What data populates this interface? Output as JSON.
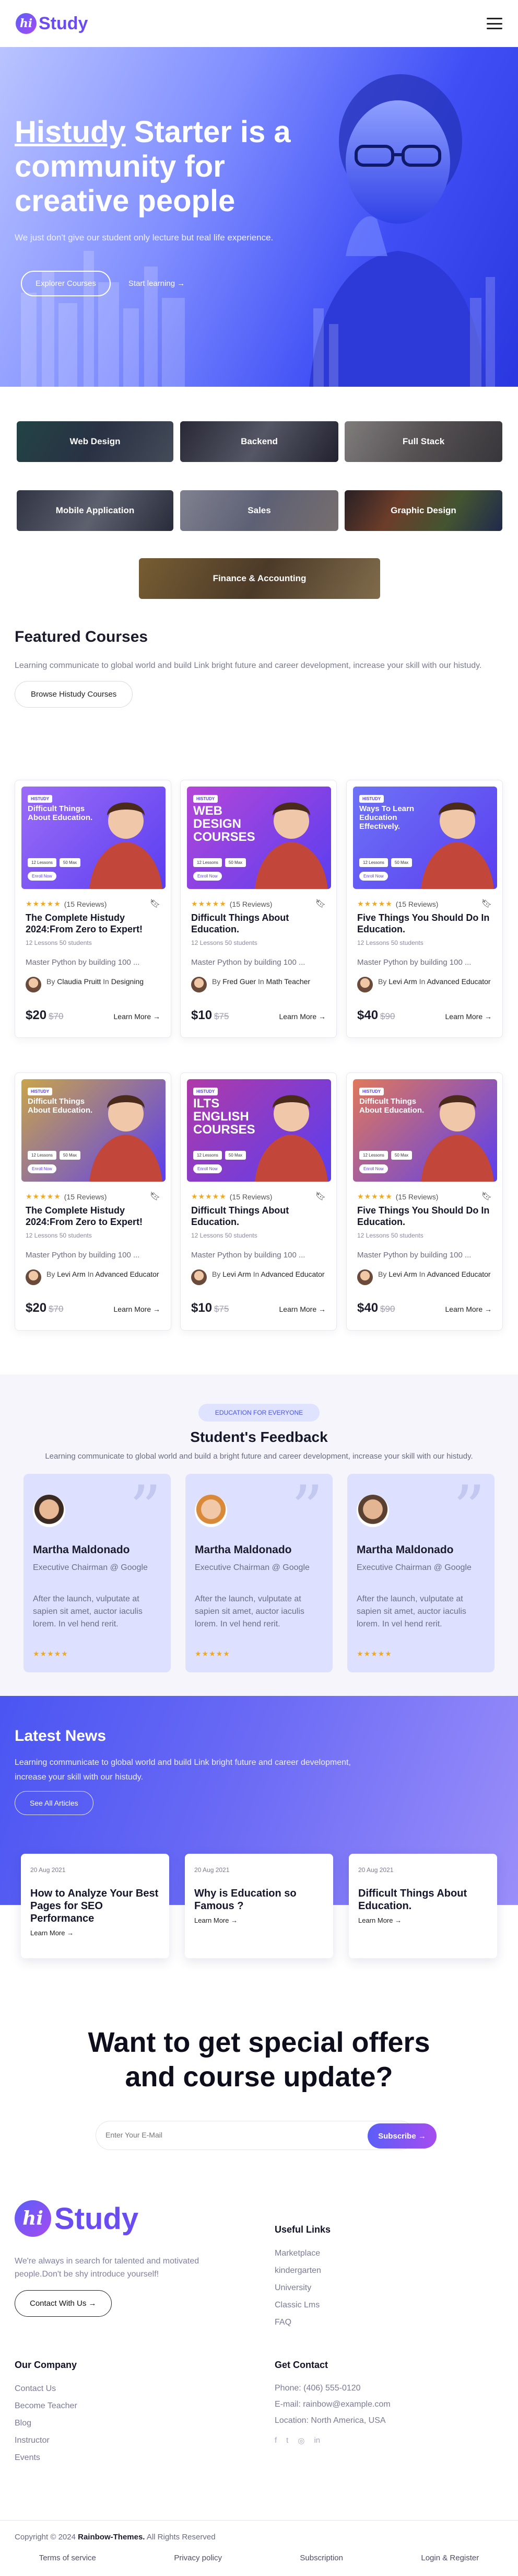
{
  "header": {
    "logo_mark": "hi",
    "logo_text": "Study"
  },
  "hero": {
    "title_brand": "Histudy",
    "title_rest": " Starter is a community for creative people",
    "subtitle": "We just don't give our student only lecture but real life experience.",
    "primary_button": "Explorer Courses",
    "secondary_link": "Start learning",
    "arrow": "→"
  },
  "categories": [
    "Web Design",
    "Backend",
    "Full Stack",
    "Mobile Application",
    "Sales",
    "Graphic Design",
    "Finance & Accounting"
  ],
  "featured": {
    "title": "Featured Courses",
    "description": "Learning communicate to global world and build Link bright future and career development, increase your skill with our histudy.",
    "button": "Browse Histudy Courses"
  },
  "courses": [
    {
      "thumb_title": "Difficult Things About Education.",
      "rating": "(15 Reviews)",
      "title": "The Complete Histudy 2024:From Zero to Expert!",
      "meta": "12 Lessons  50 students",
      "desc": "Master Python by building 100 ...",
      "by": "By",
      "author": "Claudia Pruitt",
      "in": "In",
      "category": "Designing",
      "price": "$20",
      "old_price": "$70",
      "learn": "Learn More →",
      "accent": "#9b6cf7"
    },
    {
      "thumb_title": "WEB DESIGN COURSES",
      "rating": "(15 Reviews)",
      "title": "Difficult Things About Education.",
      "meta": "12 Lessons  50 students",
      "desc": "Master Python by building 100 ...",
      "by": "By",
      "author": "Fred Guer",
      "in": "In",
      "category": "Math Teacher",
      "price": "$10",
      "old_price": "$75",
      "learn": "Learn More →",
      "accent": "#b446d8"
    },
    {
      "thumb_title": "Ways To Learn Education Effectively.",
      "rating": "(15 Reviews)",
      "title": "Five Things You Should Do In Education.",
      "meta": "12 Lessons  50 students",
      "desc": "Master Python by building 100 ...",
      "by": "By",
      "author": "Levi Arm",
      "in": "In",
      "category": "Advanced Educator",
      "price": "$40",
      "old_price": "$90",
      "learn": "Learn More →",
      "accent": "#6d72f5"
    },
    {
      "thumb_title": "Difficult Things About Education.",
      "rating": "(15 Reviews)",
      "title": "The Complete Histudy 2024:From Zero to Expert!",
      "meta": "12 Lessons  50 students",
      "desc": "Master Python by building 100 ...",
      "by": "By",
      "author": "Levi Arm",
      "in": "In",
      "category": "Advanced Educator",
      "price": "$20",
      "old_price": "$70",
      "learn": "Learn More →",
      "accent": "#c9a44a"
    },
    {
      "thumb_title": "ILTS ENGLISH COURSES",
      "rating": "(15 Reviews)",
      "title": "Difficult Things About Education.",
      "meta": "12 Lessons  50 students",
      "desc": "Master Python by building 100 ...",
      "by": "By",
      "author": "Levi Arm",
      "in": "In",
      "category": "Advanced Educator",
      "price": "$10",
      "old_price": "$75",
      "learn": "Learn More →",
      "accent": "#b03aa8"
    },
    {
      "thumb_title": "Difficult Things About Education.",
      "rating": "(15 Reviews)",
      "title": "Five Things You Should Do In Education.",
      "meta": "12 Lessons  50 students",
      "desc": "Master Python by building 100 ...",
      "by": "By",
      "author": "Levi Arm",
      "in": "In",
      "category": "Advanced Educator",
      "price": "$40",
      "old_price": "$90",
      "learn": "Learn More →",
      "accent": "#e0785a"
    }
  ],
  "thumb_ui": {
    "tag": "HISTUDY",
    "pill_one": "12 Lessons",
    "pill_two": "50 Max",
    "enroll": "Enroll Now"
  },
  "feedback": {
    "badge": "EDUCATION FOR EVERYONE",
    "title": "Student's Feedback",
    "subtitle": "Learning communicate to global world and build a bright future and career development, increase your skill with our histudy.",
    "items": [
      {
        "name": "Martha Maldonado",
        "role": "Executive Chairman @ Google",
        "text": "After the launch, vulputate at sapien sit amet, auctor iaculis lorem. In vel hend rerit.",
        "stars": "★★★★★"
      },
      {
        "name": "Martha Maldonado",
        "role": "Executive Chairman @ Google",
        "text": "After the launch, vulputate at sapien sit amet, auctor iaculis lorem. In vel hend rerit.",
        "stars": "★★★★★"
      },
      {
        "name": "Martha Maldonado",
        "role": "Executive Chairman @ Google",
        "text": "After the launch, vulputate at sapien sit amet, auctor iaculis lorem. In vel hend rerit.",
        "stars": "★★★★★"
      }
    ]
  },
  "news": {
    "title": "Latest News",
    "subtitle": "Learning communicate to global world and build Link bright future and career development, increase your skill with our histudy.",
    "button": "See All Articles",
    "items": [
      {
        "date": "20 Aug 2021",
        "title": "How to Analyze Your Best Pages for SEO Performance",
        "link": "Learn More →"
      },
      {
        "date": "20 Aug 2021",
        "title": "Why is Education so Famous ?",
        "link": "Learn More →"
      },
      {
        "date": "20 Aug 2021",
        "title": "Difficult Things About Education.",
        "link": "Learn More →"
      }
    ]
  },
  "newsletter": {
    "title_line1": "Want to get special offers",
    "title_line2": "and course update?",
    "placeholder": "Enter Your E-Mail",
    "button": "Subscribe →"
  },
  "footer": {
    "about": "We're always in search for talented and motivated people.Don't be shy introduce yourself!",
    "contact_button": "Contact With Us →",
    "useful_title": "Useful Links",
    "useful_links": [
      "Marketplace",
      "kindergarten",
      "University",
      "Classic Lms",
      "FAQ"
    ],
    "company_title": "Our Company",
    "company_links": [
      "Contact Us",
      "Become Teacher",
      "Blog",
      "Instructor",
      "Events"
    ],
    "get_contact_title": "Get Contact",
    "phone": "Phone: (406) 555-0120",
    "email": "E-mail: rainbow@example.com",
    "location": "Location: North America, USA",
    "social": [
      "f",
      "t",
      "◎",
      "in"
    ],
    "copyright_prefix": "Copyright © 2024",
    "copyright_brand": "Rainbow-Themes.",
    "copyright_suffix": " All Rights Reserved",
    "bottom_links": [
      "Terms of service",
      "Privacy policy",
      "Subscription",
      "Login & Register"
    ]
  }
}
